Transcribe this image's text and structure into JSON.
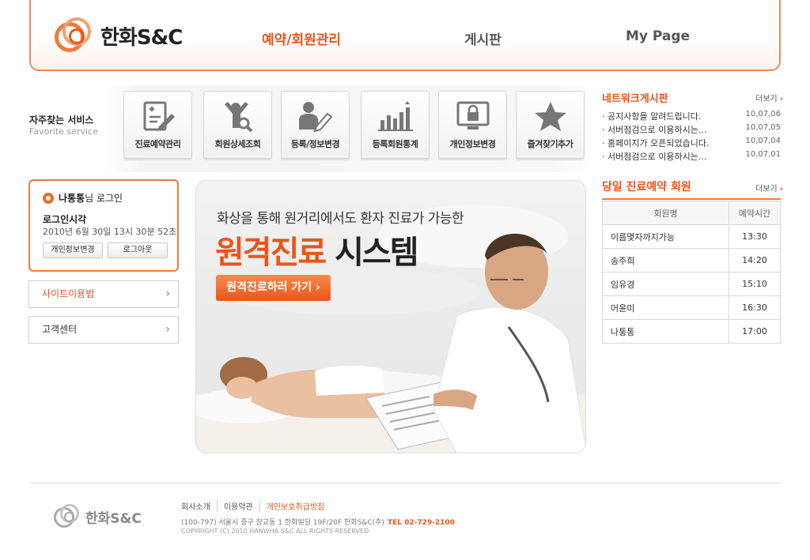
{
  "header": {
    "logo_text": "한화S&C",
    "nav": [
      "예약/회원관리",
      "게시판",
      "My Page"
    ]
  },
  "favorites": {
    "title": "자주찾는 서비스",
    "subtitle": "Favorite service",
    "items": [
      {
        "label": "진료예약관리",
        "icon": "medical-form-icon"
      },
      {
        "label": "회원상세조회",
        "icon": "user-search-icon"
      },
      {
        "label": "등록/정보변경",
        "icon": "user-edit-icon"
      },
      {
        "label": "등록회원통계",
        "icon": "bar-chart-icon"
      },
      {
        "label": "개인정보변경",
        "icon": "monitor-lock-icon"
      },
      {
        "label": "즐겨찾기추가",
        "icon": "star-icon"
      }
    ]
  },
  "login": {
    "user": "나통통",
    "suffix": "님 로그인",
    "since_label": "로그인시각",
    "since_time": "2010년 6월 30일 13시 30분 52초",
    "btn_profile": "개인정보변경",
    "btn_logout": "로그아웃"
  },
  "side_links": [
    "사이트이용법",
    "고객센터"
  ],
  "banner": {
    "line1": "화상을 통해 원거리에서도 환자 진료가 가능한",
    "line2_orange": "원격진료",
    "line2_black": " 시스템",
    "cta": "원격진료하러 가기 ›"
  },
  "network_board": {
    "title": "네트워크게시판",
    "more": "더보기",
    "posts": [
      {
        "title": "공지사항을 알려드립니다.",
        "date": "10,07,06"
      },
      {
        "title": "서버점검으로 이용하시는...",
        "date": "10,07,05"
      },
      {
        "title": "홈페이지가 오픈되었습니다.",
        "date": "10,07,04"
      },
      {
        "title": "서버점검으로 이용하시는...",
        "date": "10,07,01"
      }
    ]
  },
  "reservations": {
    "title": "당일 진료예약 회원",
    "more": "더보기",
    "headers": [
      "회원명",
      "예약시간"
    ],
    "rows": [
      [
        "이름몇자까지가능",
        "13:30"
      ],
      [
        "송주희",
        "14:20"
      ],
      [
        "임유경",
        "15:10"
      ],
      [
        "어윤미",
        "16:30"
      ],
      [
        "나통통",
        "17:00"
      ]
    ]
  },
  "footer": {
    "logo_text": "한화S&C",
    "links": [
      "회사소개",
      "이용약관",
      "개인보호취급방침"
    ],
    "address": "(100-797) 서울시 중구 장교동 1 한화빌딩 19F/20F 한화S&C(주)",
    "tel": "TEL 02-729-2100",
    "copyright": "COPYRIGHT (C) 2010 HANWHA S&C ALL RIGHTS RESERVED"
  },
  "colors": {
    "accent": "#e8551b",
    "border_accent": "#f07a3c"
  }
}
